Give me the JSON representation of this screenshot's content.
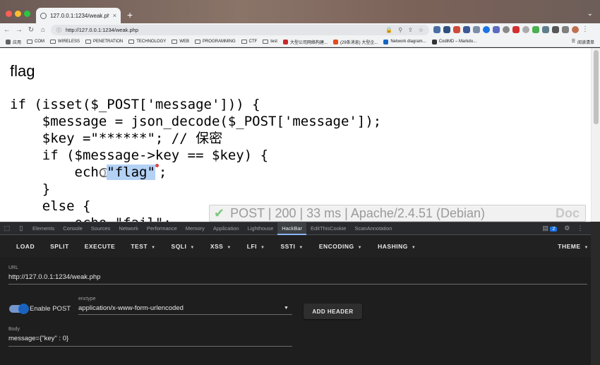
{
  "browser": {
    "tab_title": "127.0.0.1:1234/weak.php",
    "tab_close": "×",
    "new_tab": "+",
    "url": "http://127.0.0.1:1234/weak.php",
    "bookmarks": [
      "应用",
      "COM",
      "WIRELESS",
      "PENETRATION",
      "TECHNOLOGY",
      "WEB",
      "PROGRAMMING",
      "CTF",
      "test",
      "大型公司网络构建...",
      "(29条消息) 大型企...",
      "Network diagram...",
      "CodiMD – Markdo..."
    ],
    "reading_list": "阅读清单"
  },
  "page": {
    "title": "flag",
    "code_lines": [
      "if (isset($_POST['message'])) {",
      "    $message = json_decode($_POST['message']);",
      "    $key =\"******\"; // 保密",
      "    if ($message->key == $key) {",
      "        echo",
      "\"flag\"",
      ";",
      "    }",
      "    else {",
      "        echo \"fail\";"
    ]
  },
  "status_overlay": {
    "text": "POST | 200 | 33 ms | Apache/2.4.51 (Debian)",
    "doc": "Doc"
  },
  "devtools": {
    "tabs": [
      "Elements",
      "Console",
      "Sources",
      "Network",
      "Performance",
      "Memory",
      "Application",
      "Lighthouse",
      "HackBar",
      "EditThisCookie",
      "ScanAnnotation"
    ],
    "active_tab": "HackBar",
    "issues_count": "2"
  },
  "hackbar": {
    "menu": [
      {
        "label": "LOAD",
        "dropdown": false
      },
      {
        "label": "SPLIT",
        "dropdown": false
      },
      {
        "label": "EXECUTE",
        "dropdown": false
      },
      {
        "label": "TEST",
        "dropdown": true
      },
      {
        "label": "SQLI",
        "dropdown": true
      },
      {
        "label": "XSS",
        "dropdown": true
      },
      {
        "label": "LFI",
        "dropdown": true
      },
      {
        "label": "SSTI",
        "dropdown": true
      },
      {
        "label": "ENCODING",
        "dropdown": true
      },
      {
        "label": "HASHING",
        "dropdown": true
      }
    ],
    "theme_label": "THEME",
    "url_label": "URL",
    "url_value": "http://127.0.0.1:1234/weak.php",
    "enable_post_label": "Enable POST",
    "enctype_label": "enctype",
    "enctype_value": "application/x-www-form-urlencoded",
    "add_header_label": "ADD HEADER",
    "body_label": "Body",
    "body_value": "message={\"key\" : 0}"
  }
}
